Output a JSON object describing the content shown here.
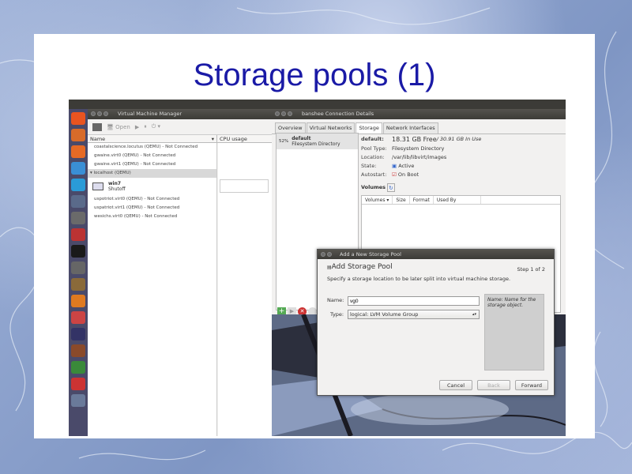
{
  "slide": {
    "title": "Storage pools (1)"
  },
  "launcher": {
    "icons": [
      "ubuntu-icon",
      "files-icon",
      "firefox-icon",
      "chrome-icon",
      "skype-icon",
      "workspace-icon",
      "terminal-icon",
      "app-icon",
      "gimp-icon",
      "document-icon",
      "archive-icon",
      "update-icon",
      "writer-icon",
      "tools-icon",
      "media-icon",
      "editor-icon",
      "bag-icon",
      "window-icon"
    ]
  },
  "vmm": {
    "window_title": "Virtual Machine Manager",
    "toolbar": {
      "open_label": "Open"
    },
    "columns": {
      "name": "Name",
      "cpu": "CPU usage"
    },
    "rows_top": [
      "coastalscience.locutus (QEMU) - Not Connected",
      "gwaine.virt0 (QEMU) - Not Connected",
      "gwaine.virt1 (QEMU) - Not Connected"
    ],
    "group": "localhost (QEMU)",
    "vm": {
      "name": "win7",
      "state": "Shutoff"
    },
    "rows_bottom": [
      "uspotriot.virt0 (QEMU) - Not Connected",
      "uspatriot.virt1 (QEMU) - Not Connected",
      "wesichs.virt0 (QEMU) - Not Connected"
    ]
  },
  "conn": {
    "window_title": "banshee Connection Details",
    "tabs": [
      "Overview",
      "Virtual Networks",
      "Storage",
      "Network Interfaces"
    ],
    "pool": {
      "percent": "52%",
      "name": "default",
      "type": "Filesystem Directory"
    },
    "details": {
      "name": "default:",
      "free": "18.31 GB Free",
      "in_use": " / 30.91 GB In Use",
      "pool_type_label": "Pool Type:",
      "pool_type": "Filesystem Directory",
      "location_label": "Location:",
      "location": "/var/lib/libvirt/images",
      "state_label": "State:",
      "state": "Active",
      "autostart_label": "Autostart:",
      "autostart": "On Boot",
      "volumes_label": "Volumes"
    },
    "vol_columns": [
      "Volumes",
      "Size",
      "Format",
      "Used By"
    ]
  },
  "dialog": {
    "window_title": "Add a New Storage Pool",
    "heading": "Add Storage Pool",
    "step": "Step 1 of 2",
    "subtitle": "Specify a storage location to be later split into virtual machine storage.",
    "name_label": "Name:",
    "name_value": "vg0",
    "type_label": "Type:",
    "type_value": "logical: LVM Volume Group",
    "hint": "Name: Name for the storage object.",
    "cancel": "Cancel",
    "back": "Back",
    "forward": "Forward"
  },
  "colors": {
    "title": "#1a1aa6",
    "launcher": "#4a4a6a",
    "titlebar": "#3c3b37"
  }
}
